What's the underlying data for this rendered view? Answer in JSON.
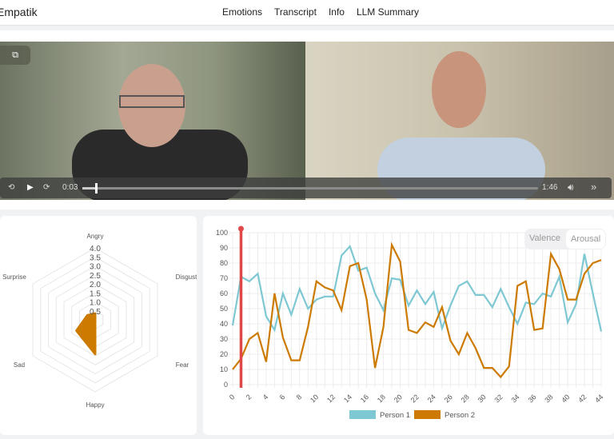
{
  "app": {
    "brand": "Empatik",
    "nav": [
      "Emotions",
      "Transcript",
      "Info",
      "LLM Summary"
    ]
  },
  "player": {
    "current_time": "0:03",
    "duration": "1:46",
    "progress": 0.028,
    "icons": [
      "pip-icon",
      "rewind-15-icon",
      "play-icon",
      "forward-15-icon",
      "volume-icon",
      "fast-forward-icon"
    ]
  },
  "toggle": {
    "options": [
      "Valence",
      "Arousal"
    ],
    "selected": "Arousal"
  },
  "chart_data": [
    {
      "type": "radar",
      "labels": [
        "Angry",
        "Disgust",
        "Fear",
        "Happy",
        "Sad",
        "Surprise"
      ],
      "ticks": [
        "0.5",
        "1.0",
        "1.5",
        "2.0",
        "2.5",
        "3.0",
        "3.5",
        "4.0"
      ],
      "rlim": [
        0,
        4
      ],
      "series": [
        {
          "values": [
            0.35,
            0,
            0,
            1.9,
            1.2,
            0.5
          ],
          "color": "#cc7a00"
        }
      ]
    },
    {
      "type": "line",
      "x": [
        0,
        1,
        2,
        3,
        4,
        5,
        6,
        7,
        8,
        9,
        10,
        11,
        12,
        13,
        14,
        15,
        16,
        17,
        18,
        19,
        20,
        21,
        22,
        23,
        24,
        25,
        26,
        27,
        28,
        29,
        30,
        31,
        32,
        33,
        34,
        35,
        36,
        37,
        38,
        39,
        40,
        41,
        42,
        43,
        44
      ],
      "xticks": [
        "0",
        "2",
        "4",
        "6",
        "8",
        "10",
        "12",
        "14",
        "16",
        "18",
        "20",
        "22",
        "24",
        "26",
        "28",
        "30",
        "32",
        "34",
        "36",
        "38",
        "40",
        "42",
        "44"
      ],
      "yticks": [
        "0",
        "10",
        "20",
        "30",
        "40",
        "50",
        "60",
        "70",
        "80",
        "90",
        "100"
      ],
      "ylim": [
        0,
        100
      ],
      "xlim": [
        0,
        44
      ],
      "grid": true,
      "legend": "bottom",
      "cursor_x": 1,
      "cursor_color": "#e04848",
      "series": [
        {
          "name": "Person 1",
          "color": "#7ec8d3",
          "values": [
            39,
            71,
            68,
            73,
            45,
            36,
            60,
            46,
            63,
            50,
            56,
            58,
            58,
            85,
            91,
            75,
            77,
            60,
            49,
            70,
            69,
            52,
            62,
            53,
            61,
            37,
            52,
            65,
            68,
            59,
            59,
            51,
            63,
            51,
            40,
            54,
            53,
            60,
            58,
            71,
            41,
            53,
            86,
            60,
            35
          ]
        },
        {
          "name": "Person 2",
          "color": "#cc7a00",
          "values": [
            10,
            17,
            30,
            34,
            15,
            60,
            31,
            16,
            16,
            38,
            68,
            64,
            62,
            49,
            78,
            80,
            56,
            11,
            38,
            92,
            81,
            36,
            34,
            41,
            38,
            51,
            29,
            20,
            34,
            24,
            11,
            11,
            5,
            12,
            65,
            68,
            36,
            37,
            86,
            76,
            56,
            56,
            73,
            80,
            82
          ]
        }
      ]
    }
  ]
}
